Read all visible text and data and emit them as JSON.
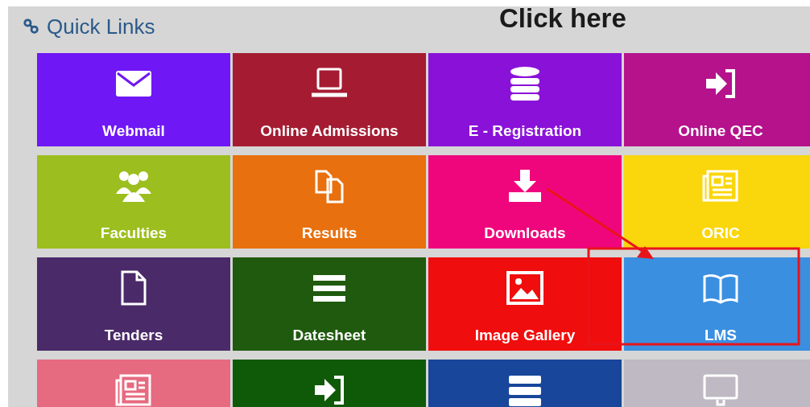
{
  "panel": {
    "title": "Quick Links"
  },
  "tiles": [
    {
      "label": "Webmail",
      "kind": "envelope",
      "color": "#6f17f5"
    },
    {
      "label": "Online Admissions",
      "kind": "laptop",
      "color": "#a51c32"
    },
    {
      "label": "E - Registration",
      "kind": "database",
      "color": "#8a12d8"
    },
    {
      "label": "Online QEC",
      "kind": "signin",
      "color": "#b5128c"
    },
    {
      "label": "Faculties",
      "kind": "people",
      "color": "#9cbe1e"
    },
    {
      "label": "Results",
      "kind": "copy",
      "color": "#e8700e"
    },
    {
      "label": "Downloads",
      "kind": "download",
      "color": "#f0067c"
    },
    {
      "label": "ORIC",
      "kind": "newspaper",
      "color": "#fad60c"
    },
    {
      "label": "Tenders",
      "kind": "file",
      "color": "#4a2a68"
    },
    {
      "label": "Datesheet",
      "kind": "list",
      "color": "#1f5a0e"
    },
    {
      "label": "Image Gallery",
      "kind": "image",
      "color": "#f00d0d"
    },
    {
      "label": "LMS",
      "kind": "book",
      "color": "#3a8fe0"
    },
    {
      "kind": "newspaper",
      "color": "#e66a80"
    },
    {
      "kind": "signin",
      "color": "#0f5a08"
    },
    {
      "kind": "server",
      "color": "#17469a"
    },
    {
      "kind": "monitor",
      "color": "#beb9c2"
    }
  ],
  "annotation": {
    "text": "Click here",
    "kind": "arrow-box"
  }
}
